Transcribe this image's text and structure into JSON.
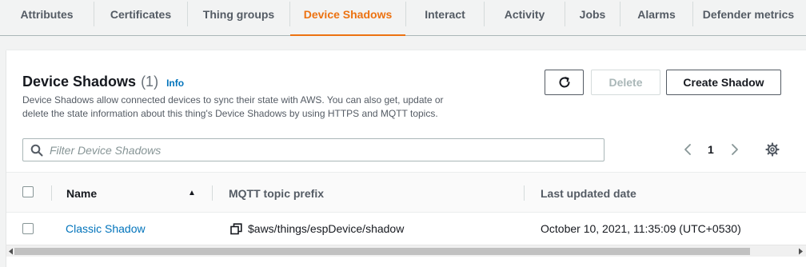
{
  "tabs": [
    {
      "label": "Attributes"
    },
    {
      "label": "Certificates"
    },
    {
      "label": "Thing groups"
    },
    {
      "label": "Device Shadows"
    },
    {
      "label": "Interact"
    },
    {
      "label": "Activity"
    },
    {
      "label": "Jobs"
    },
    {
      "label": "Alarms"
    },
    {
      "label": "Defender metrics"
    }
  ],
  "active_tab": "Device Shadows",
  "panel": {
    "title": "Device Shadows",
    "count": "(1)",
    "info": "Info",
    "description": "Device Shadows allow connected devices to sync their state with AWS. You can also get, update or delete the state information about this thing's Device Shadows by using HTTPS and MQTT topics.",
    "buttons": {
      "refresh_icon": "refresh-icon",
      "delete": "Delete",
      "create": "Create Shadow"
    },
    "filter": {
      "placeholder": "Filter Device Shadows",
      "value": ""
    },
    "pagination": {
      "current_page": "1"
    }
  },
  "table": {
    "columns": [
      "Name",
      "MQTT topic prefix",
      "Last updated date"
    ],
    "sort_indicator": "▲",
    "rows": [
      {
        "name": "Classic Shadow",
        "mqtt_prefix": "$aws/things/espDevice/shadow",
        "last_updated": "October 10, 2021, 11:35:09 (UTC+0530)"
      }
    ]
  },
  "colors": {
    "accent": "#ec7211",
    "link": "#0073bb",
    "text": "#16191f",
    "muted": "#545b64"
  }
}
